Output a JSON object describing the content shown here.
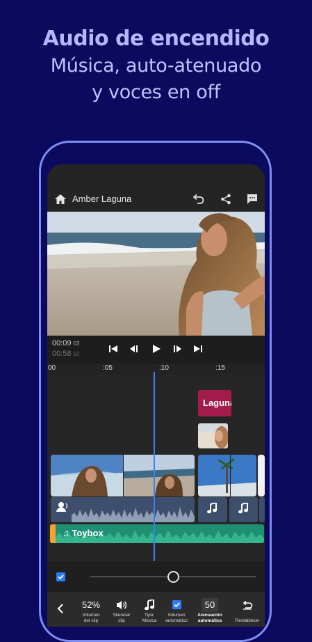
{
  "promo": {
    "headline": "Audio de encendido",
    "line1": "Música, auto-atenuado",
    "line2": "y voces en off"
  },
  "app": {
    "project_title": "Amber Laguna",
    "timecode_current": "00:09",
    "timecode_current_frames": "03",
    "timecode_total": "00:58",
    "timecode_total_frames": "10",
    "ruler_ticks": [
      "00",
      ":05",
      ":10",
      ":15"
    ],
    "title_clip_label": "Laguna",
    "music_track_label": "Toybox",
    "bottom_toolbar": [
      {
        "value": "52%",
        "label_line1": "Volumen",
        "label_line2": "del clip"
      },
      {
        "value": "",
        "label_line1": "Silenciar",
        "label_line2": "clip"
      },
      {
        "value": "",
        "label_line1": "Tipo:",
        "label_line2": "Música"
      },
      {
        "value": "",
        "label_line1": "Volumen",
        "label_line2": "automático"
      },
      {
        "value": "50",
        "label_line1": "Atenuación",
        "label_line2": "automática"
      },
      {
        "value": "",
        "label_line1": "Restablecer",
        "label_line2": ""
      }
    ],
    "slider_level": 0.5,
    "colors": {
      "background": "#0b0a5e",
      "accent_blue": "#2d7cf6",
      "title_clip": "#a21b4a",
      "music_track": "#1e8f73",
      "music_handle": "#f2a431"
    },
    "icons": [
      "home-icon",
      "undo-icon",
      "share-icon",
      "comment-icon",
      "skip-back-icon",
      "step-back-icon",
      "play-icon",
      "step-forward-icon",
      "skip-forward-icon",
      "voice-icon",
      "music-note-icon",
      "back-chevron-icon",
      "speaker-icon",
      "reset-icon"
    ]
  }
}
